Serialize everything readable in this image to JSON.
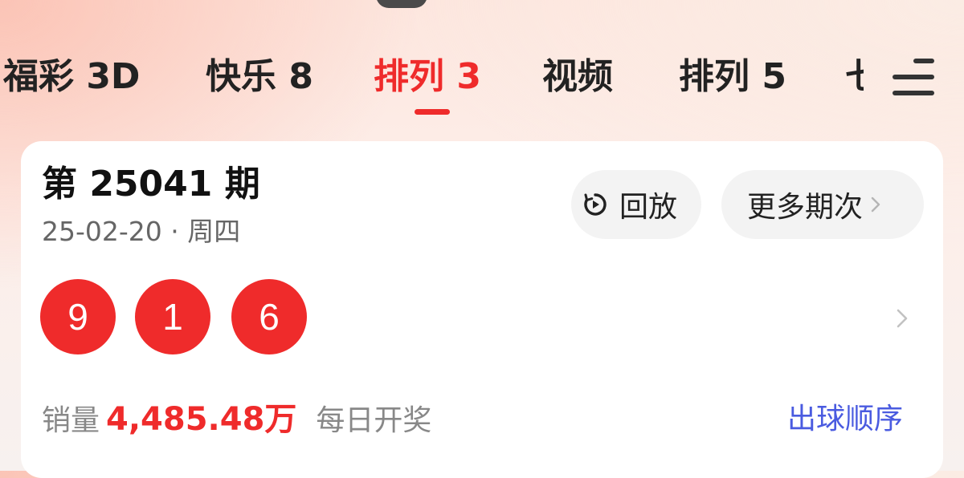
{
  "tabs": [
    {
      "label": "福彩 3D",
      "active": false
    },
    {
      "label": "快乐 8",
      "active": false
    },
    {
      "label": "排列 3",
      "active": true
    },
    {
      "label": "视频",
      "active": false
    },
    {
      "label": "排列 5",
      "active": false
    },
    {
      "label": "七",
      "active": false
    }
  ],
  "menu_icon": "hamburger-menu-icon",
  "draw": {
    "issue_title": "第 25041 期",
    "date": "25-02-20 · 周四",
    "replay_label": "回放",
    "replay_icon": "replay-clock-icon",
    "more_label": "更多期次",
    "numbers": [
      "9",
      "1",
      "6"
    ],
    "sales_label": "销量",
    "sales_amount": "4,485.48万",
    "frequency": "每日开奖",
    "order_link": "出球顺序"
  },
  "colors": {
    "accent_red": "#ef2b2b",
    "link_blue": "#4a5be0"
  }
}
